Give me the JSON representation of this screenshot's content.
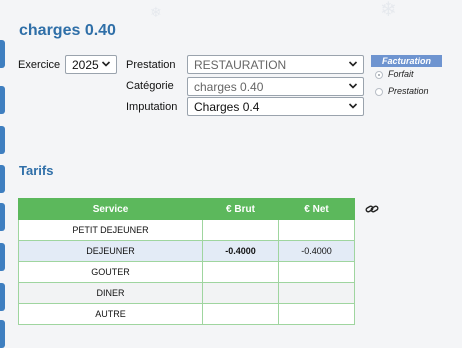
{
  "page": {
    "title": "charges 0.40"
  },
  "form": {
    "exercice_label": "Exercice",
    "exercice_value": "2025",
    "prestation_label": "Prestation",
    "prestation_value": "RESTAURATION",
    "categorie_label": "Catégorie",
    "categorie_value": "charges 0.40",
    "imputation_label": "Imputation",
    "imputation_value": "Charges 0.4"
  },
  "facturation": {
    "header": "Facturation",
    "options": [
      {
        "label": "Forfait",
        "checked": true
      },
      {
        "label": "Prestation",
        "checked": false
      }
    ]
  },
  "tarifs": {
    "title": "Tarifs",
    "columns": [
      "Service",
      "€ Brut",
      "€ Net"
    ],
    "rows": [
      {
        "service": "PETIT DEJEUNER",
        "brut": "",
        "net": ""
      },
      {
        "service": "DEJEUNER",
        "brut": "-0.4000",
        "net": "-0.4000"
      },
      {
        "service": "GOUTER",
        "brut": "",
        "net": ""
      },
      {
        "service": "DINER",
        "brut": "",
        "net": ""
      },
      {
        "service": "AUTRE",
        "brut": "",
        "net": ""
      }
    ]
  },
  "icons": {
    "link": "link-icon",
    "dropdown": "chevron-down-icon"
  },
  "colors": {
    "title_blue": "#2f6fa8",
    "table_header_green": "#5cb85c",
    "facturation_header": "#6e94d0",
    "selected_row": "#e3ebf6"
  }
}
